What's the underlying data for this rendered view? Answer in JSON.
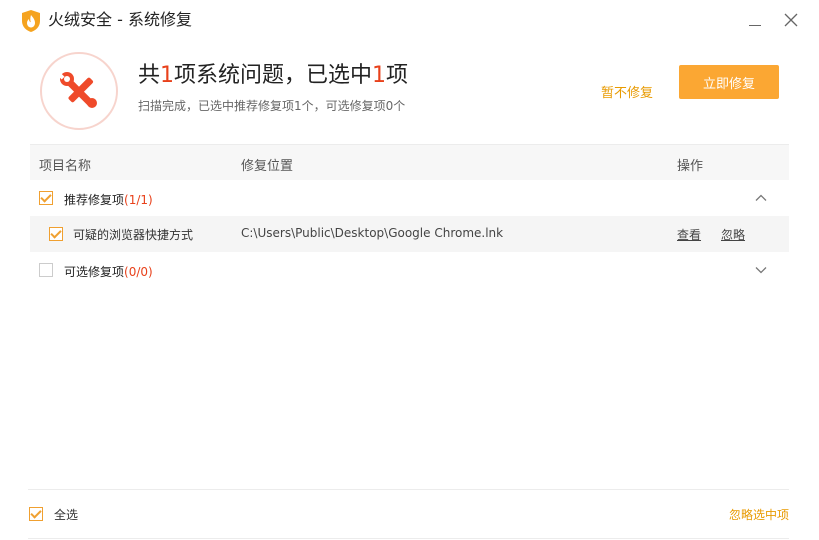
{
  "window": {
    "title": "火绒安全 - 系统修复"
  },
  "summary": {
    "headline_prefix": "共",
    "total_count": "1",
    "headline_middle": "项系统问题，已选中",
    "selected_count": "1",
    "headline_suffix": "项",
    "subtitle": "扫描完成，已选中推荐修复项1个，可选修复项0个",
    "skip_label": "暂不修复",
    "fix_label": "立即修复"
  },
  "table": {
    "col_name": "项目名称",
    "col_location": "修复位置",
    "col_action": "操作"
  },
  "groups": [
    {
      "label": "推荐修复项",
      "count": "(1/1)",
      "checked": true,
      "expanded": true,
      "items": [
        {
          "name": "可疑的浏览器快捷方式",
          "location": "C:\\Users\\Public\\Desktop\\Google Chrome.lnk",
          "view_label": "查看",
          "ignore_label": "忽略",
          "checked": true
        }
      ]
    },
    {
      "label": "可选修复项",
      "count": "(0/0)",
      "checked": false,
      "expanded": false,
      "items": []
    }
  ],
  "footer": {
    "select_all_label": "全选",
    "ignore_selected_label": "忽略选中项"
  },
  "icons": {
    "app_logo": "huorong-flame-shield-icon",
    "repair": "wrench-screwdriver-icon",
    "minimize": "minimize-icon",
    "close": "close-icon",
    "collapse": "chevron-up-icon",
    "expand": "chevron-down-icon"
  },
  "colors": {
    "accent_orange": "#fba733",
    "link_orange": "#e89a00",
    "highlight_red": "#e8411b",
    "icon_red": "#ef4a2a"
  }
}
